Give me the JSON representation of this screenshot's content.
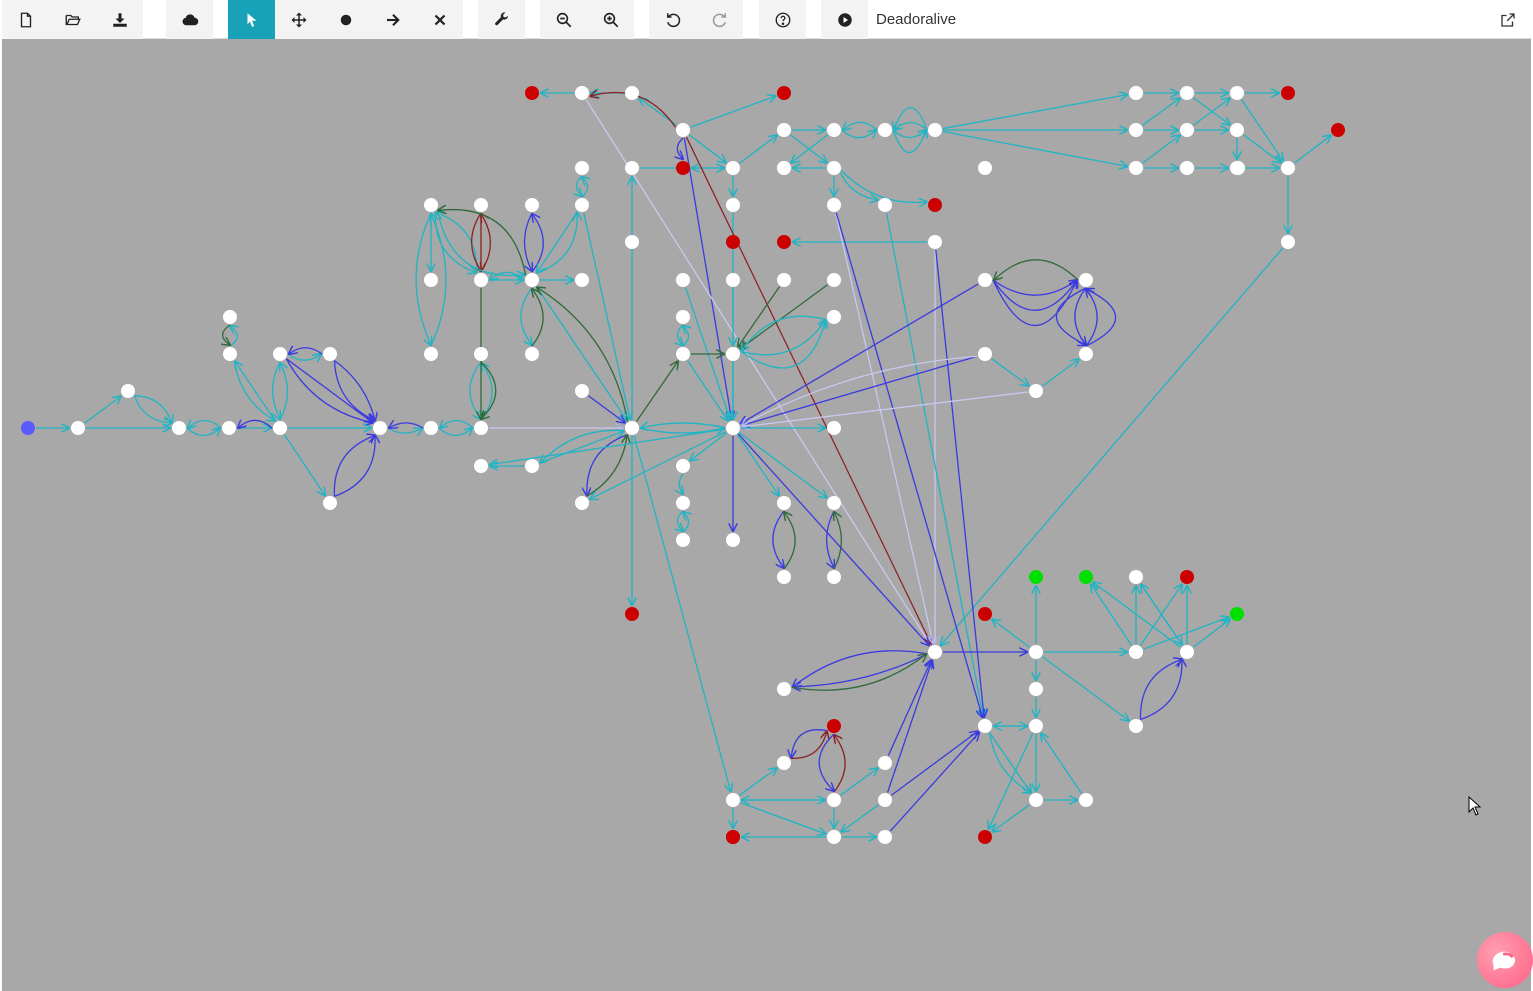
{
  "toolbar": {
    "groups": [
      {
        "buttons": [
          {
            "name": "new-file-button",
            "icon": "file-icon"
          },
          {
            "name": "open-file-button",
            "icon": "folder-open-icon"
          },
          {
            "name": "download-button",
            "icon": "download-icon"
          }
        ]
      },
      {
        "buttons": [
          {
            "name": "cloud-button",
            "icon": "cloud-icon"
          }
        ]
      },
      {
        "buttons": [
          {
            "name": "select-tool-button",
            "icon": "cursor-arrow-icon",
            "active": true
          },
          {
            "name": "move-tool-button",
            "icon": "move-arrows-icon"
          },
          {
            "name": "add-state-tool-button",
            "icon": "circle-icon"
          },
          {
            "name": "add-transition-tool-button",
            "icon": "arrow-right-icon"
          },
          {
            "name": "delete-tool-button",
            "icon": "x-icon"
          }
        ]
      },
      {
        "buttons": [
          {
            "name": "settings-button",
            "icon": "wrench-icon"
          }
        ]
      },
      {
        "buttons": [
          {
            "name": "zoom-out-button",
            "icon": "zoom-out-icon"
          },
          {
            "name": "zoom-in-button",
            "icon": "zoom-in-icon"
          }
        ]
      },
      {
        "buttons": [
          {
            "name": "undo-button",
            "icon": "undo-icon"
          },
          {
            "name": "redo-button",
            "icon": "redo-icon"
          }
        ]
      },
      {
        "buttons": [
          {
            "name": "help-button",
            "icon": "question-circle-icon"
          }
        ]
      },
      {
        "buttons": [
          {
            "name": "play-button",
            "icon": "play-circle-icon"
          }
        ]
      }
    ],
    "title": "Deadoralive",
    "external_icon": "external-link-icon"
  },
  "colors": {
    "background": "#a8a8a8",
    "accent": "#17a2b8",
    "node_default": "#ffffff",
    "node_start": "#5a5aff",
    "node_dead": "#cc0000",
    "node_alive": "#00e000",
    "edge_default": "#1fb5c4",
    "edge_blue": "#3a3ae0",
    "edge_dark_red": "#8a2222",
    "edge_dark_green": "#2f6b3a",
    "edge_lavender": "#c8c8f0"
  },
  "graph": {
    "nodes": [
      {
        "id": "n_start",
        "type": "start"
      },
      {
        "id": "n1"
      },
      {
        "id": "n2"
      },
      {
        "id": "n3"
      },
      {
        "id": "n4"
      },
      {
        "id": "n5"
      },
      {
        "id": "n6"
      },
      {
        "id": "n7"
      },
      {
        "id": "n8"
      },
      {
        "id": "n9"
      },
      {
        "id": "n10"
      },
      {
        "id": "n11"
      },
      {
        "id": "n12"
      },
      {
        "id": "n13"
      },
      {
        "id": "n14"
      },
      {
        "id": "n15"
      },
      {
        "id": "n16"
      },
      {
        "id": "n17"
      },
      {
        "id": "n18"
      },
      {
        "id": "n19"
      },
      {
        "id": "n20"
      },
      {
        "id": "n21"
      },
      {
        "id": "n22"
      },
      {
        "id": "n23"
      },
      {
        "id": "n24"
      },
      {
        "id": "n25"
      },
      {
        "id": "n26"
      },
      {
        "id": "n27"
      },
      {
        "id": "n28"
      },
      {
        "id": "n29"
      },
      {
        "id": "n30"
      },
      {
        "id": "n31"
      },
      {
        "id": "n32"
      },
      {
        "id": "n33"
      },
      {
        "id": "n34"
      },
      {
        "id": "n35"
      },
      {
        "id": "n36"
      },
      {
        "id": "n37"
      },
      {
        "id": "n38"
      },
      {
        "id": "n39"
      },
      {
        "id": "n40"
      },
      {
        "id": "n41"
      },
      {
        "id": "n42"
      },
      {
        "id": "n43"
      },
      {
        "id": "n44"
      },
      {
        "id": "n45"
      },
      {
        "id": "n46"
      },
      {
        "id": "n47"
      },
      {
        "id": "n48"
      },
      {
        "id": "n49"
      },
      {
        "id": "n50"
      },
      {
        "id": "n51"
      },
      {
        "id": "n52"
      },
      {
        "id": "n53"
      },
      {
        "id": "n54"
      },
      {
        "id": "n55"
      },
      {
        "id": "n56"
      },
      {
        "id": "n57"
      },
      {
        "id": "n58"
      },
      {
        "id": "n59"
      },
      {
        "id": "n60"
      },
      {
        "id": "n61"
      },
      {
        "id": "n62"
      },
      {
        "id": "n63"
      },
      {
        "id": "n64"
      },
      {
        "id": "n65"
      },
      {
        "id": "n66"
      },
      {
        "id": "n67"
      },
      {
        "id": "n68"
      },
      {
        "id": "n69"
      },
      {
        "id": "n70"
      },
      {
        "id": "n71"
      },
      {
        "id": "n72"
      },
      {
        "id": "n73"
      },
      {
        "id": "n74"
      },
      {
        "id": "n75"
      },
      {
        "id": "n76"
      },
      {
        "id": "n77"
      },
      {
        "id": "n78"
      },
      {
        "id": "n79"
      },
      {
        "id": "n80"
      },
      {
        "id": "n81"
      },
      {
        "id": "n82"
      },
      {
        "id": "n83"
      },
      {
        "id": "n84"
      },
      {
        "id": "n85"
      },
      {
        "id": "n86"
      },
      {
        "id": "n87"
      },
      {
        "id": "n88"
      },
      {
        "id": "n89"
      },
      {
        "id": "n90"
      },
      {
        "id": "n91"
      },
      {
        "id": "n92"
      },
      {
        "id": "n93"
      },
      {
        "id": "n94"
      },
      {
        "id": "n95"
      },
      {
        "id": "n96"
      },
      {
        "id": "n97"
      },
      {
        "id": "n98"
      },
      {
        "id": "n99"
      },
      {
        "id": "n100"
      },
      {
        "id": "n101"
      },
      {
        "id": "n102"
      },
      {
        "id": "n103"
      },
      {
        "id": "d1",
        "type": "dead"
      },
      {
        "id": "d2",
        "type": "dead"
      },
      {
        "id": "d3",
        "type": "dead"
      },
      {
        "id": "d4",
        "type": "dead"
      },
      {
        "id": "d5",
        "type": "dead"
      },
      {
        "id": "d6",
        "type": "dead"
      },
      {
        "id": "d7",
        "type": "dead"
      },
      {
        "id": "d8",
        "type": "dead"
      },
      {
        "id": "d9",
        "type": "dead"
      },
      {
        "id": "d10",
        "type": "dead"
      },
      {
        "id": "d11",
        "type": "dead"
      },
      {
        "id": "d12",
        "type": "dead"
      },
      {
        "id": "d13",
        "type": "dead"
      },
      {
        "id": "d14",
        "type": "dead"
      },
      {
        "id": "d15",
        "type": "dead"
      },
      {
        "id": "a1",
        "type": "alive"
      },
      {
        "id": "a2",
        "type": "alive"
      },
      {
        "id": "a3",
        "type": "alive"
      }
    ]
  },
  "chat_icon": "chat-bubble-icon"
}
